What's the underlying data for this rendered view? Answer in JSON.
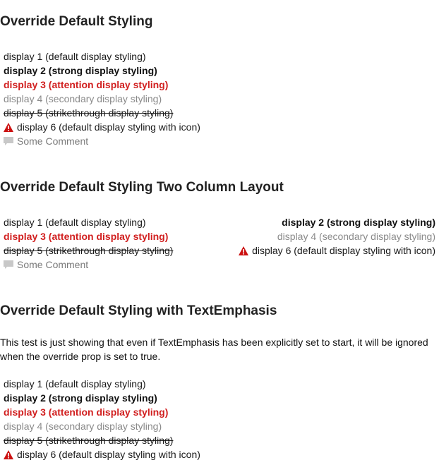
{
  "section1": {
    "title": "Override Default Styling",
    "display1": "display 1 (default display styling)",
    "display2": "display 2 (strong display styling)",
    "display3": "display 3 (attention display styling)",
    "display4": "display 4 (secondary display styling)",
    "display5": "display 5 (strikethrough display styling)",
    "display6": "display 6 (default display styling with icon)",
    "comment": "Some Comment"
  },
  "section2": {
    "title": "Override Default Styling Two Column Layout",
    "display1": "display 1 (default display styling)",
    "display2": "display 2 (strong display styling)",
    "display3": "display 3 (attention display styling)",
    "display4": "display 4 (secondary display styling)",
    "display5": "display 5 (strikethrough display styling)",
    "display6": "display 6 (default display styling with icon)",
    "comment": "Some Comment"
  },
  "section3": {
    "title": "Override Default Styling with TextEmphasis",
    "description": "This test is just showing that even if TextEmphasis has been explicitly set to start, it will be ignored when the override prop is set to true.",
    "display1": "display 1 (default display styling)",
    "display2": "display 2 (strong display styling)",
    "display3": "display 3 (attention display styling)",
    "display4": "display 4 (secondary display styling)",
    "display5": "display 5 (strikethrough display styling)",
    "display6": "display 6 (default display styling with icon)"
  },
  "icons": {
    "warning": "warning-icon",
    "comment": "comment-icon"
  },
  "colors": {
    "attention": "#d11f1f",
    "secondary": "#8a8a8a",
    "warning_icon": "#cc1111",
    "comment_icon": "#c8c8c8"
  }
}
